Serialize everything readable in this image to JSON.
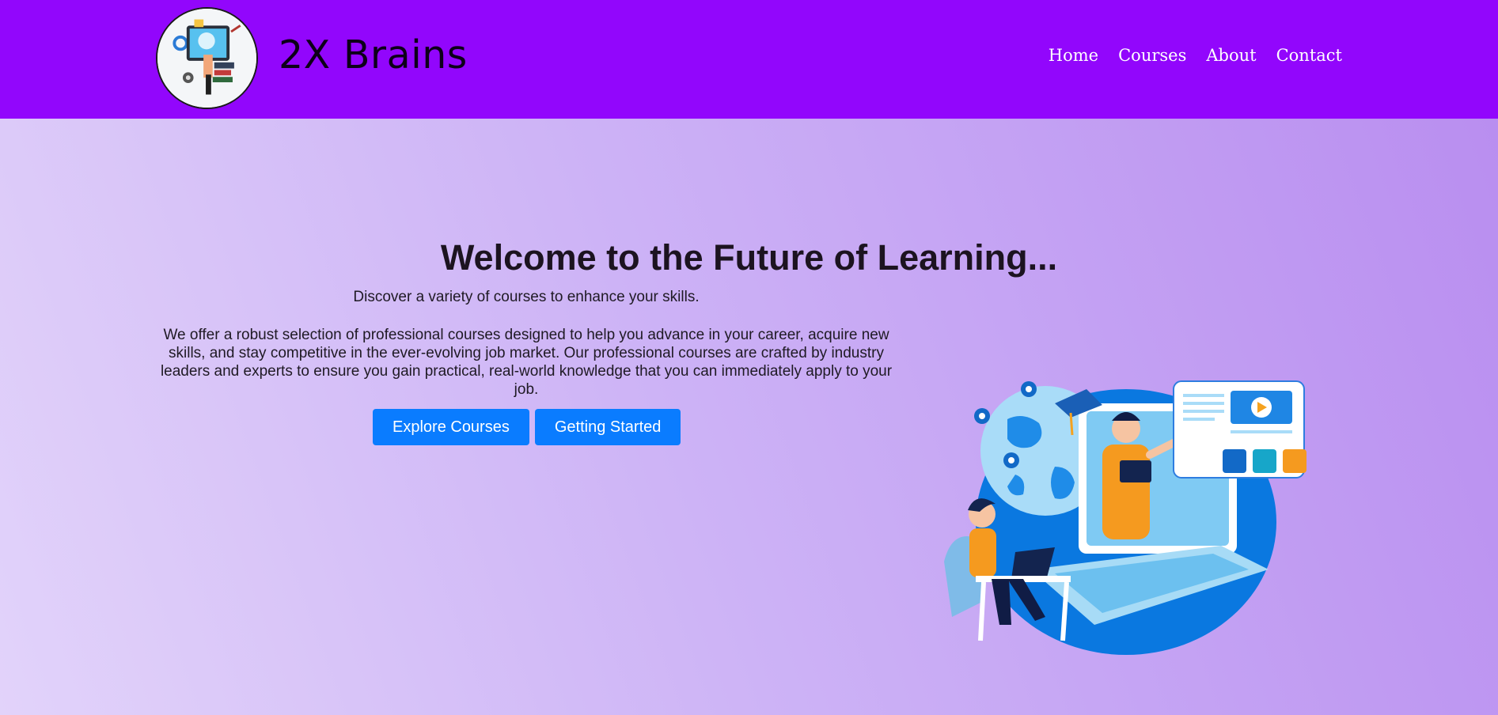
{
  "navbar": {
    "brand": "2X Brains",
    "links": [
      "Home",
      "Courses",
      "About",
      "Contact"
    ]
  },
  "hero": {
    "title": "Welcome to the Future of Learning...",
    "subtitle": "Discover a variety of courses to enhance your skills.",
    "description": "We offer a robust selection of professional courses designed to help you advance in your career, acquire new skills, and stay competitive in the ever-evolving job market. Our professional courses are crafted by industry leaders and experts to ensure you gain practical, real-world knowledge that you can immediately apply to your job.",
    "buttons": {
      "explore": "Explore Courses",
      "start": "Getting Started"
    }
  },
  "colors": {
    "navbar_bg": "#9206fc",
    "button_bg": "#0a7cff",
    "gradient_start": "#e2d3fa",
    "gradient_end": "#b98ef0"
  },
  "icons": [
    "brain-logo-icon",
    "online-learning-illustration"
  ]
}
